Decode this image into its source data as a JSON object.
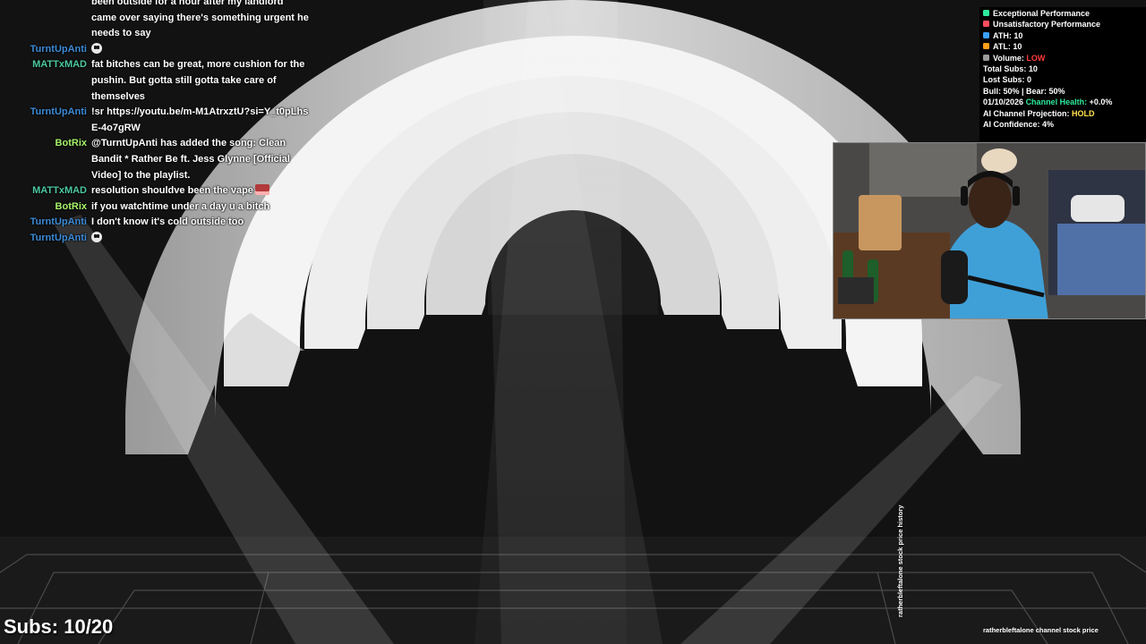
{
  "chat": [
    {
      "user": "",
      "user_color": "#5ab0ff",
      "message": "been outside for a hour after my landlord came over saying there's something urgent he needs to say",
      "emote": ""
    },
    {
      "user": "TurntUpAnti",
      "user_color": "#3c8ad6",
      "message": "",
      "emote": "skull"
    },
    {
      "user": "MATTxMAD",
      "user_color": "#4cc7a1",
      "message": "fat bitches can be great, more cushion for the pushin. But gotta still gotta take care of themselves",
      "emote": ""
    },
    {
      "user": "TurntUpAnti",
      "user_color": "#3c8ad6",
      "message": "!sr https://youtu.be/m-M1AtrxztU?si=Y_t0pLhsE-4o7gRW",
      "emote": ""
    },
    {
      "user": "BotRix",
      "user_color": "#a6f26a",
      "message": "@TurntUpAnti has added the song: Clean Bandit * Rather Be ft. Jess Glynne [Official Video] to the playlist.",
      "emote": ""
    },
    {
      "user": "MATTxMAD",
      "user_color": "#4cc7a1",
      "message": "resolution shouldve been the vape",
      "emote": "red"
    },
    {
      "user": "BotRix",
      "user_color": "#a6f26a",
      "message": "if you watchtime under a day u a bitch",
      "emote": ""
    },
    {
      "user": "TurntUpAnti",
      "user_color": "#3c8ad6",
      "message": "I don't know it's cold outside too",
      "emote": ""
    },
    {
      "user": "TurntUpAnti",
      "user_color": "#3c8ad6",
      "message": "",
      "emote": "skull"
    }
  ],
  "stats": {
    "legend": [
      {
        "label": "Exceptional Performance",
        "color": "#2ee89a"
      },
      {
        "label": "Unsatisfactory Performance",
        "color": "#ff4d5e"
      },
      {
        "label": "ATH: 10",
        "color": "#3aa0ff"
      },
      {
        "label": "ATL: 10",
        "color": "#ff9f1a"
      }
    ],
    "volume_label": "Volume:",
    "volume_value": "LOW",
    "volume_color": "#ff3b3b",
    "volume_sq_color": "#9a9a9a",
    "total_subs": "Total Subs: 10",
    "lost_subs": "Lost Subs: 0",
    "bull_bear": "Bull: 50% | Bear: 50%",
    "date": "01/10/2026",
    "health_label": "Channel Health:",
    "health_value": "+0.0%",
    "health_color": "#2ee89a",
    "projection_label": "AI Channel Projection:",
    "projection_value": "HOLD",
    "projection_color": "#ffe14a",
    "confidence": "AI Confidence: 4%"
  },
  "subs_counter": "Subs: 10/20",
  "vertical_label": "ratherbleftalone stock price history",
  "bottom_label": "ratherbleftalone channel stock price"
}
